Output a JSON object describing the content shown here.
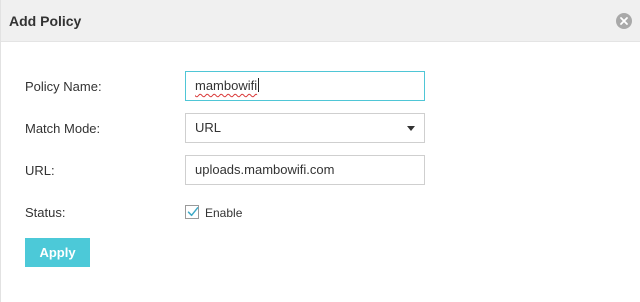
{
  "dialog": {
    "title": "Add Policy",
    "close_icon": "close-circle-icon"
  },
  "form": {
    "policy_name": {
      "label": "Policy Name:",
      "value": "mambowifi"
    },
    "match_mode": {
      "label": "Match Mode:",
      "value": "URL"
    },
    "url": {
      "label": "URL:",
      "value": "uploads.mambowifi.com"
    },
    "status": {
      "label": "Status:",
      "checkbox_label": "Enable",
      "checked": true
    }
  },
  "actions": {
    "apply_label": "Apply"
  },
  "colors": {
    "accent": "#4cc9d8",
    "focus_border": "#4fc6d6",
    "header_bg": "#f0f0f0"
  }
}
